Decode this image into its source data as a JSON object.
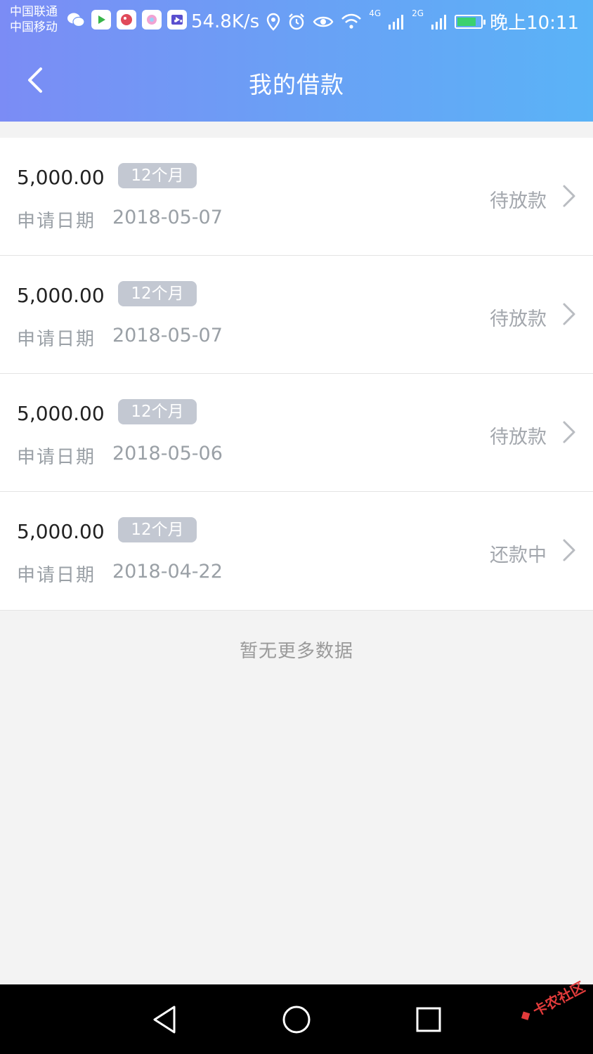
{
  "status_bar": {
    "carrier1": "中国联通",
    "carrier2": "中国移动",
    "dots": "··",
    "speed": "54.8K/s",
    "net1": "4G",
    "net2": "2G",
    "time": "晚上10:11"
  },
  "header": {
    "title": "我的借款"
  },
  "loans": [
    {
      "amount": "5,000.00",
      "term": "12个月",
      "date_label": "申请日期",
      "date": "2018-05-07",
      "status": "待放款"
    },
    {
      "amount": "5,000.00",
      "term": "12个月",
      "date_label": "申请日期",
      "date": "2018-05-07",
      "status": "待放款"
    },
    {
      "amount": "5,000.00",
      "term": "12个月",
      "date_label": "申请日期",
      "date": "2018-05-06",
      "status": "待放款"
    },
    {
      "amount": "5,000.00",
      "term": "12个月",
      "date_label": "申请日期",
      "date": "2018-04-22",
      "status": "还款中"
    }
  ],
  "footer_text": "暂无更多数据",
  "watermark": "卡农社区",
  "colors": {
    "header_start": "#7b8cf5",
    "header_end": "#5ab3f7",
    "badge": "#c3c8d2",
    "muted_text": "#9aa0a6"
  },
  "icons": [
    "back-arrow-icon",
    "chevron-right-icon",
    "wechat-icon",
    "location-icon",
    "alarm-icon",
    "eye-icon",
    "wifi-icon",
    "signal-icon",
    "battery-icon",
    "nav-back-icon",
    "nav-home-icon",
    "nav-recents-icon"
  ]
}
